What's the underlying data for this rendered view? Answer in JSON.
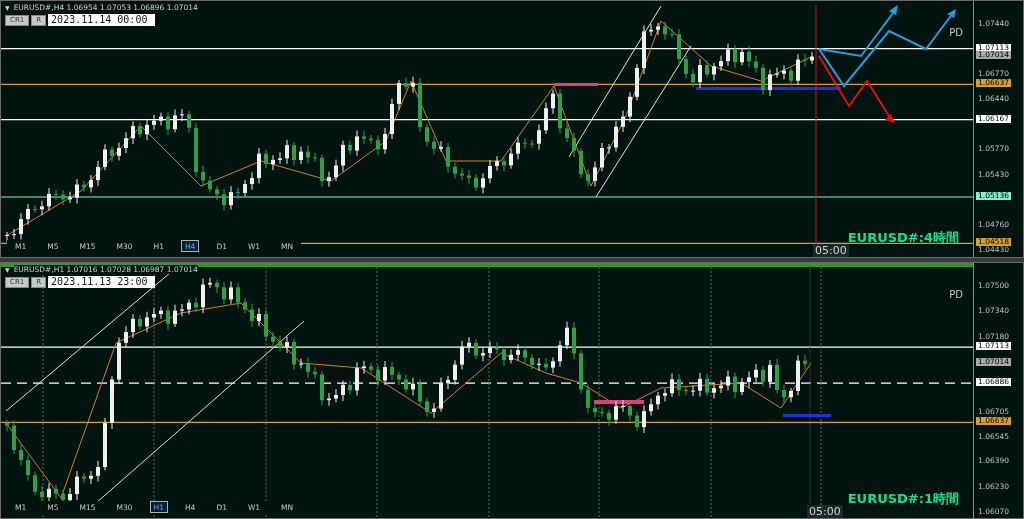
{
  "panels": [
    {
      "menu_glyph": "▼",
      "symbol_line": "EURUSD#,H4  1.06954 1.07053 1.06896 1.07014",
      "buttons": [
        "CR1",
        "R"
      ],
      "date": "2023.11.14 00:00",
      "note": "PD",
      "time_marker": "05:00",
      "title": "EURUSD#:4時間",
      "axis_labels": [
        "1.07440",
        "1.06770",
        "1.06440",
        "1.05770",
        "1.05430",
        "1.04760",
        "1.04430"
      ],
      "price_tags": [
        {
          "text": "1.07113",
          "color": "#ffffff",
          "kind": "solid"
        },
        {
          "text": "1.07014",
          "color": "#a8a8a8",
          "kind": "none"
        },
        {
          "text": "1.06637",
          "color": "#d8a020",
          "kind": "solid"
        },
        {
          "text": "1.06167",
          "color": "#ffffff",
          "kind": "solid"
        },
        {
          "text": "1.05136",
          "color": "#80f0c8",
          "kind": "solid"
        },
        {
          "text": "1.04518",
          "color": "#d8a020",
          "kind": "solid"
        }
      ],
      "timeframes": [
        {
          "label": "M1",
          "selected": false
        },
        {
          "label": "M5",
          "selected": false
        },
        {
          "label": "M15",
          "selected": false
        },
        {
          "label": "M30",
          "selected": false
        },
        {
          "label": "H1",
          "selected": false
        },
        {
          "label": "H4",
          "selected": true
        },
        {
          "label": "D1",
          "selected": false
        },
        {
          "label": "W1",
          "selected": false
        },
        {
          "label": "MN",
          "selected": false
        }
      ]
    },
    {
      "menu_glyph": "▼",
      "symbol_line": "EURUSD#,H1  1.07016 1.07028 1.06987 1.07014",
      "buttons": [
        "CR1",
        "R"
      ],
      "date": "2023.11.13 23:00",
      "note": "PD",
      "time_marker": "05:00",
      "title": "EURUSD#:1時間",
      "axis_labels": [
        "1.07500",
        "1.07340",
        "1.07180",
        "1.06705",
        "1.06545",
        "1.06390",
        "1.06230",
        "1.06070"
      ],
      "price_tags": [
        {
          "text": "1.07113",
          "color": "#ffffff",
          "kind": "solid"
        },
        {
          "text": "1.07014",
          "color": "#a8a8a8",
          "kind": "none"
        },
        {
          "text": "1.06886",
          "color": "#ffffff",
          "kind": "dashed"
        },
        {
          "text": "1.06637",
          "color": "#d8a020",
          "kind": "solid"
        }
      ],
      "timeframes": [
        {
          "label": "M1",
          "selected": false
        },
        {
          "label": "M5",
          "selected": false
        },
        {
          "label": "M15",
          "selected": false
        },
        {
          "label": "M30",
          "selected": false
        },
        {
          "label": "H1",
          "selected": true
        },
        {
          "label": "H4",
          "selected": false
        },
        {
          "label": "D1",
          "selected": false
        },
        {
          "label": "W1",
          "selected": false
        },
        {
          "label": "MN",
          "selected": false
        }
      ]
    }
  ]
}
